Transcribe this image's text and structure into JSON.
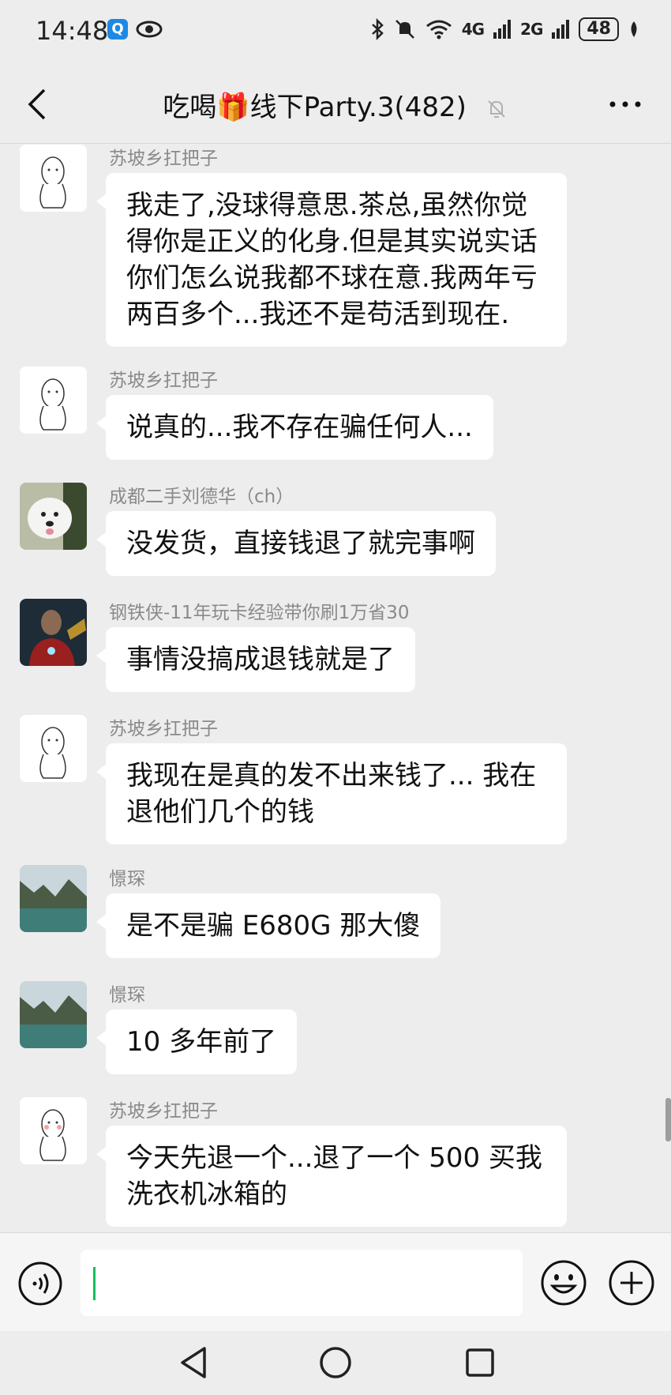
{
  "status_bar": {
    "time": "14:48",
    "network_4g": "4G",
    "network_2g": "2G",
    "battery": "48"
  },
  "header": {
    "title": "吃喝🎁线下Party.3(482)"
  },
  "messages": [
    {
      "sender": "苏坡乡扛把子",
      "text": "我走了,没球得意思.茶总,虽然你觉得你是正义的化身.但是其实说实话你们怎么说我都不球在意.我两年亏两百多个...我还不是苟活到现在."
    },
    {
      "sender": "苏坡乡扛把子",
      "text": "说真的...我不存在骗任何人..."
    },
    {
      "sender": "成都二手刘德华（ch）",
      "text": "没发货，直接钱退了就完事啊"
    },
    {
      "sender": "钢铁侠-11年玩卡经验带你刷1万省30",
      "text": "事情没搞成退钱就是了"
    },
    {
      "sender": "苏坡乡扛把子",
      "text": "我现在是真的发不出来钱了... 我在退他们几个的钱"
    },
    {
      "sender": "憬琛",
      "text": "是不是骗 E680G 那大傻"
    },
    {
      "sender": "憬琛",
      "text": "10 多年前了"
    },
    {
      "sender": "苏坡乡扛把子",
      "text": "今天先退一个...退了一个 500 买我洗衣机冰箱的"
    }
  ],
  "input": {
    "value": ""
  }
}
